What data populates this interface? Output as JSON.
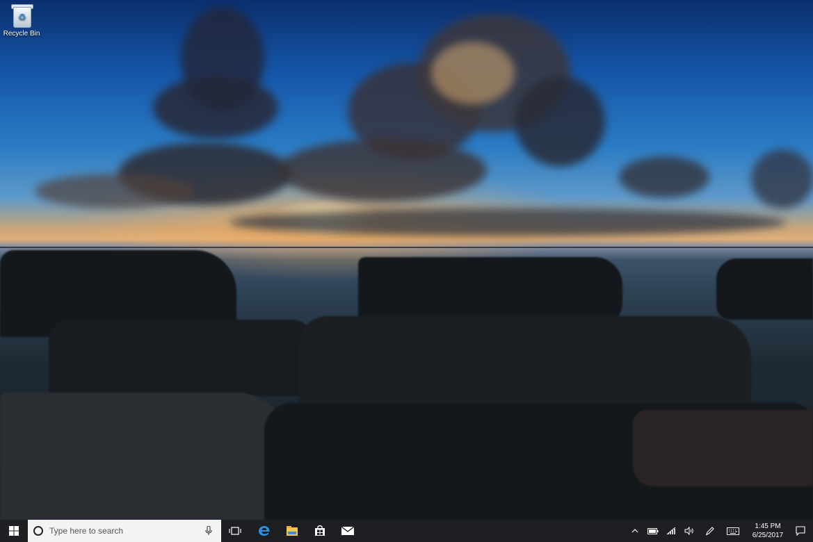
{
  "desktop": {
    "icons": [
      {
        "label": "Recycle Bin",
        "icon": "recycle-bin-icon"
      }
    ]
  },
  "taskbar": {
    "start_icon": "windows-logo-icon",
    "search": {
      "placeholder": "Type here to search",
      "icon": "cortana-circle-icon",
      "mic_icon": "microphone-icon"
    },
    "task_view_icon": "task-view-icon",
    "pinned_apps": [
      {
        "name": "Microsoft Edge",
        "icon": "edge-icon"
      },
      {
        "name": "File Explorer",
        "icon": "file-explorer-icon"
      },
      {
        "name": "Store",
        "icon": "store-icon"
      },
      {
        "name": "Mail",
        "icon": "mail-icon"
      }
    ],
    "tray": {
      "icons": [
        "chevron-up-icon",
        "battery-icon",
        "network-icon",
        "volume-icon",
        "pen-icon",
        "keyboard-icon"
      ],
      "time": "1:45 PM",
      "date": "6/25/2017",
      "notification_icon": "action-center-icon"
    },
    "colors": {
      "background": "#1d1f22",
      "search_bg": "#f3f3f3",
      "accent": "#7fb6f0"
    }
  }
}
